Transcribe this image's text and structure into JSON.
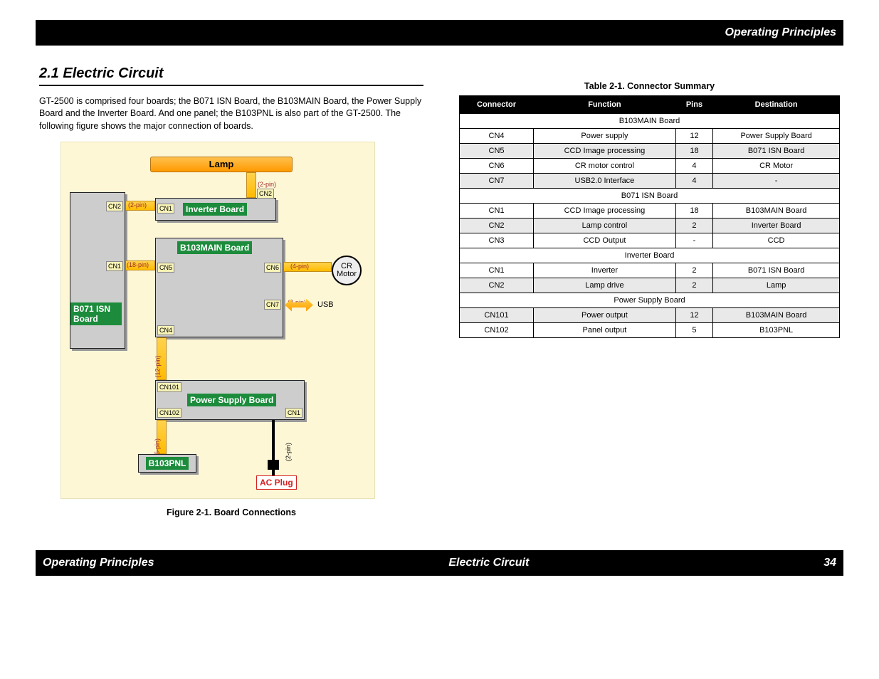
{
  "header_right": "Operating Principles",
  "footer_left": "Operating Principles",
  "footer_center": "Electric Circuit",
  "footer_right": "34",
  "section_heading": "2.1  Electric Circuit",
  "intro_text": "GT-2500 is comprised four boards; the B071 ISN Board, the B103MAIN Board, the Power Supply Board and the Inverter Board. And one panel; the B103PNL is also part of the GT-2500. The following figure shows the major connection of boards.",
  "figure_caption": "Figure 2-1.  Board Connections",
  "table_caption": "Table 2-1.  Connector Summary",
  "diagram": {
    "lamp": "Lamp",
    "isn_board": "B071 ISN Board",
    "inverter_board": "Inverter Board",
    "main_board": "B103MAIN Board",
    "power_board": "Power Supply Board",
    "pnl": "B103PNL",
    "ac_plug": "AC Plug",
    "cr_motor": "CR Motor",
    "usb": "USB",
    "pins": {
      "isn_cn2": "CN2",
      "isn_cn1": "CN1",
      "inv_cn1": "CN1",
      "inv_cn2": "CN2",
      "main_cn5": "CN5",
      "main_cn6": "CN6",
      "main_cn7": "CN7",
      "main_cn4": "CN4",
      "ps_cn101": "CN101",
      "ps_cn102": "CN102",
      "ps_cn1": "CN1"
    },
    "cable_labels": {
      "c2": "(2-pin)",
      "c18": "(18-pin)",
      "c4": "(4-pin)",
      "c12": "(12-pin)",
      "c5": "(5-pin)"
    }
  },
  "table": {
    "headers": [
      "Connector",
      "Function",
      "Pins",
      "Destination"
    ],
    "sections": [
      {
        "title": "B103MAIN Board",
        "rows": [
          {
            "cells": [
              "CN4",
              "Power supply",
              "12",
              "Power Supply Board"
            ],
            "shade": false
          },
          {
            "cells": [
              "CN5",
              "CCD Image processing",
              "18",
              "B071 ISN Board"
            ],
            "shade": true
          },
          {
            "cells": [
              "CN6",
              "CR motor control",
              "4",
              "CR Motor"
            ],
            "shade": false
          },
          {
            "cells": [
              "CN7",
              "USB2.0 Interface",
              "4",
              "-"
            ],
            "shade": true
          }
        ]
      },
      {
        "title": "B071 ISN Board",
        "rows": [
          {
            "cells": [
              "CN1",
              "CCD Image processing",
              "18",
              "B103MAIN Board"
            ],
            "shade": false
          },
          {
            "cells": [
              "CN2",
              "Lamp control",
              "2",
              "Inverter Board"
            ],
            "shade": true
          },
          {
            "cells": [
              "CN3",
              "CCD Output",
              "-",
              "CCD"
            ],
            "shade": false
          }
        ]
      },
      {
        "title": "Inverter Board",
        "rows": [
          {
            "cells": [
              "CN1",
              "Inverter",
              "2",
              "B071 ISN Board"
            ],
            "shade": false
          },
          {
            "cells": [
              "CN2",
              "Lamp drive",
              "2",
              "Lamp"
            ],
            "shade": true
          }
        ]
      },
      {
        "title": "Power Supply Board",
        "rows": [
          {
            "cells": [
              "CN101",
              "Power output",
              "12",
              "B103MAIN Board"
            ],
            "shade": true
          },
          {
            "cells": [
              "CN102",
              "Panel output",
              "5",
              "B103PNL"
            ],
            "shade": false
          }
        ]
      }
    ]
  }
}
